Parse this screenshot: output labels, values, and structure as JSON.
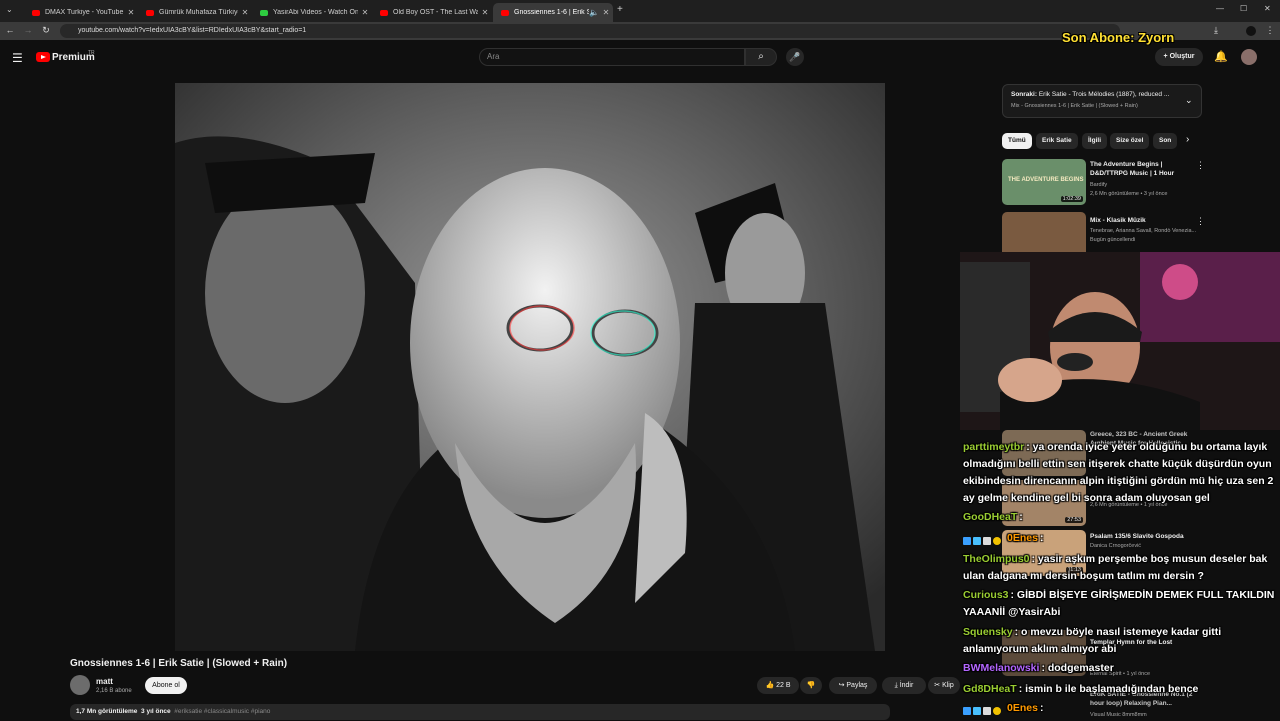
{
  "tabs": [
    {
      "label": "DMAX Turkiye - YouTube",
      "fav": "youtube"
    },
    {
      "label": "Gümrük Muhafaza Türkiye 10. S",
      "fav": "youtube"
    },
    {
      "label": "YasirAbi Videos - Watch On-De",
      "fav": "kick"
    },
    {
      "label": "Old Boy OST - The Last Waltz -",
      "fav": "youtube"
    },
    {
      "label": "Gnossiennes 1-6 | Erik Satie",
      "fav": "youtube",
      "active": true
    }
  ],
  "address": {
    "url": "youtube.com/watch?v=IedxUIA3cBY&list=RDIedxUIA3cBY&start_radio=1"
  },
  "header": {
    "brand": "Premium",
    "region": "TR",
    "search_placeholder": "Ara",
    "create_label": "Oluştur"
  },
  "overlay": {
    "last_subscriber": "Son Abone: Zyorn"
  },
  "video": {
    "title": "Gnossiennes 1-6 | Erik Satie | (Slowed + Rain)",
    "channel": "matt",
    "subscribers": "2,16 B abone",
    "subscribe_label": "Abone ol",
    "likes": "22 B",
    "share_label": "Paylaş",
    "download_label": "İndir",
    "clip_label": "Klip",
    "views": "1,7 Mn görüntüleme",
    "age": "3 yıl önce",
    "tags": "#eriksatie #classicalmusic #piano"
  },
  "up_next": {
    "label": "Sonraki:",
    "title": "Erik Satie - Trois Mélodies (1887), reduced ...",
    "subtitle": "Mix - Gnossiennes 1-6 | Erik Satie | (Slowed + Rain)"
  },
  "chips": [
    "Tümü",
    "Erik Satie",
    "İlgili",
    "Size özel",
    "Son"
  ],
  "recommendations": [
    {
      "title": "The Adventure Begins | D&D/TTRPG Music | 1 Hour",
      "channel": "Bardify",
      "meta": "2,6 Mn görüntüleme • 3 yıl önce",
      "duration": "1:02:39",
      "thumb_text": "THE ADVENTURE BEGINS",
      "color": "#6a8f6a"
    },
    {
      "title": "Mix - Klasik Müzik",
      "channel": "Tenebrae, Arianna Savall, Rondò Venezia...",
      "meta": "Bugün güncellendi",
      "duration": "",
      "thumb_text": "",
      "color": "#7a5a40"
    }
  ],
  "chat_messages": [
    {
      "user": "parttimeytbr",
      "color": "#9acd32",
      "text": ": ya orenda iyice yeter olduğunu bu ortama layık olmadığını belli ettin sen itişerek chatte küçük düşürdün oyun ekibindesin direncanın alpin itiştiğini gördün mü hiç uza sen 2 ay gelme kendine gel bi sonra adam oluyosan gel",
      "badges": false
    },
    {
      "user": "GooDHeaT",
      "color": "#9acd32",
      "text": ":",
      "badges": false
    },
    {
      "user": "0Enes",
      "color": "#ff9900",
      "text": ":",
      "badges": true
    },
    {
      "user": "TheOlimpus0",
      "color": "#9acd32",
      "text": ": yasir aşkım perşembe boş musun deseler bak ulan dalgana mı dersin boşum tatlım mı dersin ?",
      "badges": false
    },
    {
      "user": "Curious3",
      "color": "#9acd32",
      "text": ": GİBDİ BİŞEYE GİRİŞMEDİN DEMEK FULL TAKILDIN YAAANİİ @YasirAbi",
      "badges": false
    },
    {
      "user": "Squensky",
      "color": "#9acd32",
      "text": ": o mevzu böyle nasıl istemeye kadar gitti anlamıyorum aklım almıyor abi",
      "badges": false
    },
    {
      "user": "BWMelanowski",
      "color": "#b366ff",
      "text": ": dodgemaster",
      "badges": false
    },
    {
      "user": "Gd8DHeaT",
      "color": "#9acd32",
      "text": ": ismin b ile başlamadığından bence",
      "badges": false
    },
    {
      "user": "0Enes",
      "color": "#ff9900",
      "text": ":",
      "badges": true
    }
  ],
  "background_recs": [
    {
      "title": "Greece, 323 BC - Ancient Greek Ambient Music for Hellenistic...",
      "meta": "2,6 Mn görüntüleme • 1 yıl önce",
      "duration": "27:53"
    },
    {
      "title": "Psalam 135/6 Slavite Gospoda",
      "meta": "Danica Crnogorčević",
      "duration": "11:13"
    },
    {
      "title": "Templar Hymn for the Lost",
      "meta": "Eternal Spirit • 1 yıl önce",
      "duration": "2:00:00"
    },
    {
      "title": "ERIK SATIE - Gnossienne No.1 (2 hour loop) Relaxing Pian...",
      "meta": "Visual Music 8mm8mm",
      "duration": ""
    }
  ]
}
